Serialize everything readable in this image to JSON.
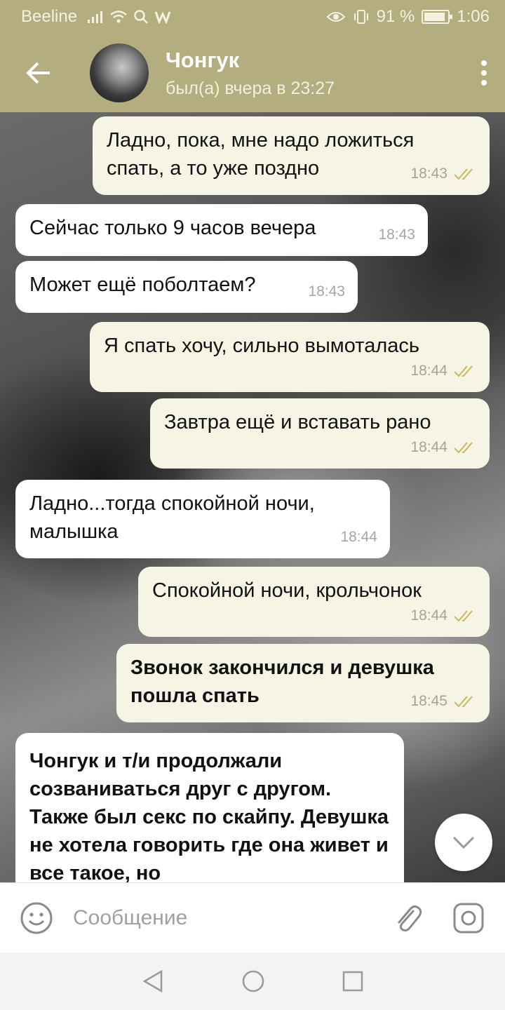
{
  "status_bar": {
    "carrier": "Beeline",
    "battery_text": "91 %",
    "battery_level": 0.91,
    "time": "1:06",
    "icons": [
      "signal-icon",
      "wifi-icon",
      "search-icon",
      "w-app-icon",
      "eye-icon",
      "vibrate-icon",
      "battery-icon"
    ]
  },
  "header": {
    "name": "Чонгук",
    "status": "был(а) вчера в 23:27",
    "accent_color": "#b3ad80"
  },
  "messages": [
    {
      "direction": "out",
      "text": "Ладно, пока, мне надо ложиться спать, а то уже поздно",
      "time": "18:43",
      "read": true
    },
    {
      "direction": "in",
      "text": "Сейчас только 9 часов вечера",
      "time": "18:43"
    },
    {
      "direction": "in",
      "text": "Может ещё поболтаем?",
      "time": "18:43"
    },
    {
      "direction": "out",
      "text": "Я спать хочу, сильно вымоталась",
      "time": "18:44",
      "read": true
    },
    {
      "direction": "out",
      "text": "Завтра ещё и вставать рано",
      "time": "18:44",
      "read": true
    },
    {
      "direction": "in",
      "text": "Ладно...тогда спокойной ночи, малышка",
      "time": "18:44"
    },
    {
      "direction": "out",
      "text": "Спокойной ночи, крольчонок",
      "time": "18:44",
      "read": true
    },
    {
      "direction": "out",
      "text": "Звонок закончился и девушка пошла спать",
      "time": "18:45",
      "read": true,
      "bold": true
    },
    {
      "direction": "in",
      "text": "Чонгук и т/и продолжали созваниваться друг с другом. Также был секс по скайпу. Девушка не хотела говорить где она живет и все такое, но",
      "bold": true
    }
  ],
  "input": {
    "placeholder": "Сообщение"
  },
  "colors": {
    "outgoing_bubble": "#f6f5e5",
    "incoming_bubble": "#ffffff",
    "read_check": "#c9b75a"
  }
}
